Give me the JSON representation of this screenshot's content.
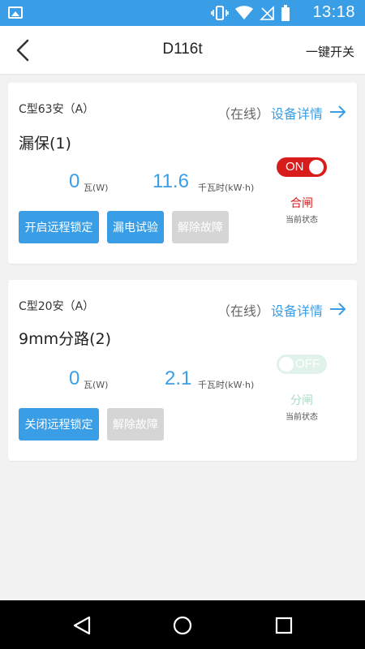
{
  "status_bar": {
    "time": "13:18"
  },
  "header": {
    "title": "D116t",
    "right_action": "一键开关"
  },
  "devices": [
    {
      "model": "C型63安（A）",
      "status": "（在线）",
      "detail_link": "设备详情",
      "name": "漏保(1)",
      "power_value": "0",
      "power_unit": "瓦(W)",
      "energy_value": "11.6",
      "energy_unit": "千瓦时(kW·h)",
      "toggle_label": "ON",
      "state_text": "合闸",
      "state_caption": "当前状态",
      "buttons": [
        "开启远程锁定",
        "漏电试验",
        "解除故障"
      ],
      "state_color": "#d81b1b"
    },
    {
      "model": "C型20安（A）",
      "status": "（在线）",
      "detail_link": "设备详情",
      "name": "9mm分路(2)",
      "power_value": "0",
      "power_unit": "瓦(W)",
      "energy_value": "2.1",
      "energy_unit": "千瓦时(kW·h)",
      "toggle_label": "OFF",
      "state_text": "分闸",
      "state_caption": "当前状态",
      "buttons": [
        "关闭远程锁定",
        "解除故障"
      ],
      "state_color": "#a8dcc6"
    }
  ],
  "colors": {
    "accent": "#3a9ee6",
    "on": "#d81b1b",
    "off_bg": "#e0f2ea",
    "off_text": "#a8dcc6",
    "disabled": "#d5d5d5"
  }
}
